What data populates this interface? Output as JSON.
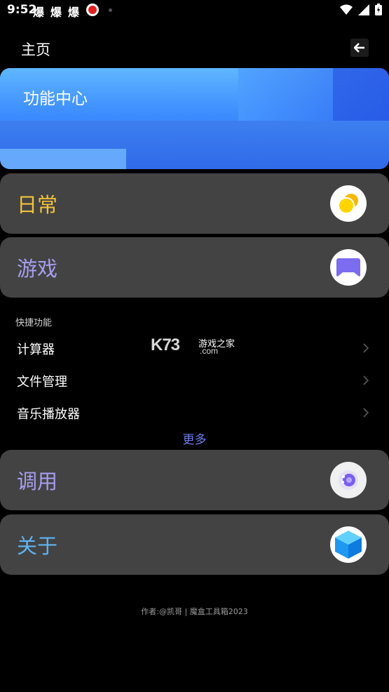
{
  "status_bar": {
    "time": "9:52",
    "notifications": [
      "爆",
      "爆",
      "爆"
    ]
  },
  "header": {
    "title": "主页"
  },
  "banner": {
    "title": "功能中心"
  },
  "cards": [
    {
      "label": "日常",
      "color": "#f2c23a",
      "icon": "sun-moon-icon"
    },
    {
      "label": "游戏",
      "color": "#a79ef0",
      "icon": "gamepad-icon"
    },
    {
      "label": "调用",
      "color": "#a79ef0",
      "icon": "gear-icon"
    },
    {
      "label": "关于",
      "color": "#5fb4f2",
      "icon": "cube-icon"
    }
  ],
  "quick_functions": {
    "section_label": "快捷功能",
    "items": [
      {
        "label": "计算器"
      },
      {
        "label": "文件管理"
      },
      {
        "label": "音乐播放器"
      }
    ],
    "more_label": "更多"
  },
  "watermark": {
    "logo": "K73",
    "text": "游戏之家",
    "sub": ".com"
  },
  "footer": {
    "text": "作者:@凯哥 | 魔盒工具箱2023"
  }
}
